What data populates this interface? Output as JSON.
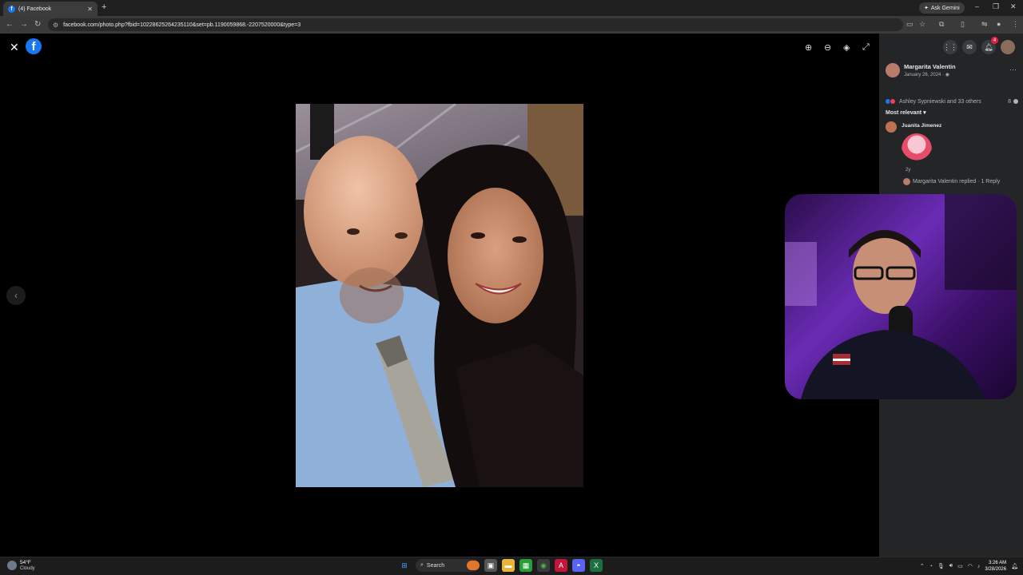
{
  "browser": {
    "tab_title": "(4) Facebook",
    "tab_favicon_letter": "f",
    "url": "facebook.com/photo.php?fbid=10228625264235110&set=pb.1190059868.-2207520000&type=3",
    "ask_gemini_label": "Ask Gemini"
  },
  "viewer": {
    "logo_letter": "f"
  },
  "post": {
    "author": "Margarita Valentin",
    "date": "January 26, 2024 · ◉",
    "reactions_text": "Ashley Sypniewski and 33 others",
    "comment_count": "8",
    "sort_label": "Most relevant",
    "sort_caret": "▾",
    "comment": {
      "author": "Juanita Jimenez",
      "time": "2y"
    },
    "reply_text": "Margarita Valentin replied · 1 Reply"
  },
  "notifications": {
    "badge": "4"
  },
  "taskbar": {
    "temperature": "54°F",
    "condition": "Cloudy",
    "search_label": "Search",
    "time": "3:26 AM",
    "date": "3/28/2026"
  },
  "colors": {
    "facebook_blue": "#1877f2",
    "panel_bg": "#242526",
    "notification_red": "#e41e3f"
  }
}
